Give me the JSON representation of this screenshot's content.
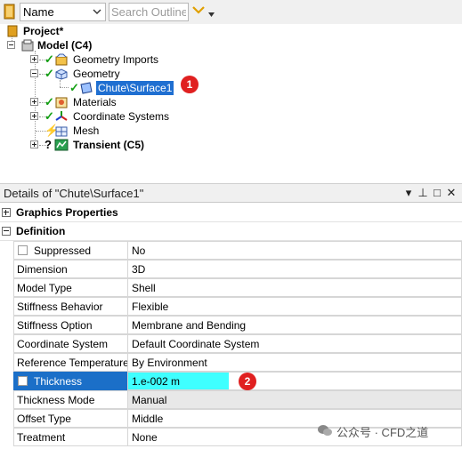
{
  "toolbar": {
    "name_combo": "Name",
    "search_placeholder": "Search Outline"
  },
  "tree": {
    "project": "Project*",
    "model": "Model (C4)",
    "geometry_imports": "Geometry Imports",
    "geometry": "Geometry",
    "surface": "Chute\\Surface1",
    "materials": "Materials",
    "coordinate_systems": "Coordinate Systems",
    "mesh": "Mesh",
    "transient": "Transient (C5)",
    "badge1": "1"
  },
  "details": {
    "title": "Details of \"Chute\\Surface1\"",
    "pin_icon": "pin-icon",
    "groups": {
      "graphics": "Graphics Properties",
      "definition": "Definition"
    },
    "rows": [
      {
        "name": "Suppressed",
        "value": "No"
      },
      {
        "name": "Dimension",
        "value": "3D"
      },
      {
        "name": "Model Type",
        "value": "Shell"
      },
      {
        "name": "Stiffness Behavior",
        "value": "Flexible"
      },
      {
        "name": "Stiffness Option",
        "value": "Membrane and Bending"
      },
      {
        "name": "Coordinate System",
        "value": "Default Coordinate System"
      },
      {
        "name": "Reference Temperature",
        "value": "By Environment"
      },
      {
        "name": "Thickness",
        "value": "1.e-002 m"
      },
      {
        "name": "Thickness Mode",
        "value": "Manual"
      },
      {
        "name": "Offset Type",
        "value": "Middle"
      },
      {
        "name": "Treatment",
        "value": "None"
      }
    ],
    "badge2": "2"
  },
  "watermark": "公众号 · CFD之道",
  "colors": {
    "selection": "#1f6fd1",
    "row_highlight": "#1b6fc8",
    "value_highlight": "#3fffff",
    "badge": "#e02020",
    "check": "#14a014"
  }
}
